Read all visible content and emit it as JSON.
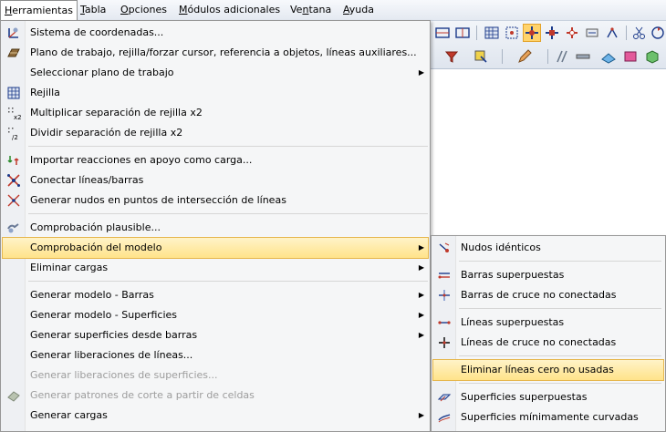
{
  "menubar": {
    "items": [
      {
        "label": "Herramientas",
        "mnemonic": "H",
        "active": true
      },
      {
        "label": "Tabla",
        "mnemonic": "T"
      },
      {
        "label": "Opciones",
        "mnemonic": "O"
      },
      {
        "label": "Módulos adicionales",
        "mnemonic": "M"
      },
      {
        "label": "Ventana",
        "mnemonic": "n"
      },
      {
        "label": "Ayuda",
        "mnemonic": "A"
      }
    ]
  },
  "menu": {
    "items": [
      {
        "label": "Sistema de coordenadas...",
        "icon": "coordinate-system-icon"
      },
      {
        "label": "Plano de trabajo, rejilla/forzar cursor, referencia a objetos, líneas auxiliares...",
        "icon": "work-plane-icon"
      },
      {
        "label": "Seleccionar plano de trabajo",
        "submenu": true
      },
      {
        "label": "Rejilla",
        "icon": "grid-icon"
      },
      {
        "label": "Multiplicar separación de rejilla x2",
        "icon": "grid-multiply-icon"
      },
      {
        "label": "Dividir separación de rejilla x2",
        "icon": "grid-divide-icon"
      },
      {
        "label": "Importar reacciones en apoyo como carga...",
        "icon": "import-reactions-icon"
      },
      {
        "label": "Conectar líneas/barras",
        "icon": "connect-lines-icon"
      },
      {
        "label": "Generar nudos en puntos de intersección de líneas",
        "icon": "intersection-nodes-icon"
      },
      {
        "label": "Comprobación plausible...",
        "icon": "plausibility-check-icon"
      },
      {
        "label": "Comprobación del modelo",
        "submenu": true,
        "highlighted": true
      },
      {
        "label": "Eliminar cargas",
        "submenu": true
      },
      {
        "label": "Generar modelo - Barras",
        "submenu": true
      },
      {
        "label": "Generar modelo - Superficies",
        "submenu": true
      },
      {
        "label": "Generar superficies desde barras",
        "submenu": true
      },
      {
        "label": "Generar liberaciones de líneas..."
      },
      {
        "label": "Generar liberaciones de superficies...",
        "disabled": true
      },
      {
        "label": "Generar patrones de corte a partir de celdas",
        "disabled": true,
        "icon": "cutting-pattern-icon"
      },
      {
        "label": "Generar cargas",
        "submenu": true
      }
    ]
  },
  "submenu": {
    "items": [
      {
        "label": "Nudos idénticos",
        "icon": "identical-nodes-icon"
      },
      {
        "label": "Barras superpuestas",
        "icon": "overlapping-members-icon"
      },
      {
        "label": "Barras de cruce no conectadas",
        "icon": "crossing-members-icon"
      },
      {
        "label": "Líneas superpuestas",
        "icon": "overlapping-lines-icon"
      },
      {
        "label": "Líneas de cruce no conectadas",
        "icon": "crossing-lines-icon"
      },
      {
        "label": "Eliminar líneas cero no usadas",
        "highlighted": true
      },
      {
        "label": "Superficies superpuestas",
        "icon": "overlapping-surfaces-icon"
      },
      {
        "label": "Superficies mínimamente curvadas",
        "icon": "curved-surfaces-icon"
      }
    ]
  },
  "colors": {
    "highlight_top": "#fff3c8",
    "highlight_bottom": "#ffe38a",
    "highlight_border": "#e6b74e",
    "menu_bg": "#f5f6f7",
    "disabled_text": "#9d9d9d"
  }
}
